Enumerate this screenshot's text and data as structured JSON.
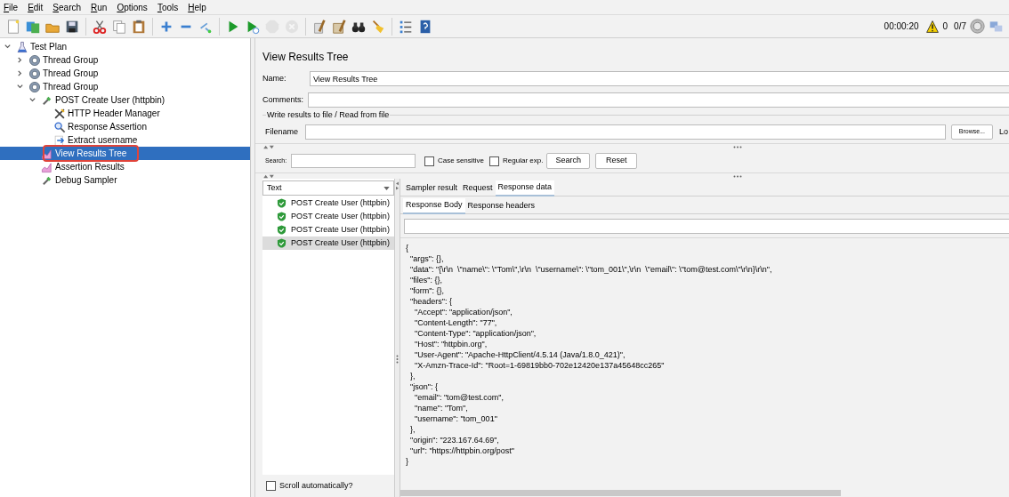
{
  "menu": [
    "File",
    "Edit",
    "Search",
    "Run",
    "Options",
    "Tools",
    "Help"
  ],
  "toolbar": [
    {
      "kind": "new",
      "disabled": false
    },
    {
      "kind": "templates",
      "disabled": false
    },
    {
      "kind": "open",
      "disabled": false
    },
    {
      "kind": "save",
      "disabled": false
    },
    {
      "kind": "separator"
    },
    {
      "kind": "cut",
      "disabled": false
    },
    {
      "kind": "copy",
      "disabled": false
    },
    {
      "kind": "paste",
      "disabled": false
    },
    {
      "kind": "separator"
    },
    {
      "kind": "expand",
      "disabled": false
    },
    {
      "kind": "collapse",
      "disabled": false
    },
    {
      "kind": "toggle",
      "disabled": false
    },
    {
      "kind": "separator"
    },
    {
      "kind": "start",
      "disabled": false
    },
    {
      "kind": "start-no-pauses",
      "disabled": false
    },
    {
      "kind": "stop",
      "disabled": true
    },
    {
      "kind": "shutdown",
      "disabled": true
    },
    {
      "kind": "separator"
    },
    {
      "kind": "clear",
      "disabled": false
    },
    {
      "kind": "clear-all",
      "disabled": false
    },
    {
      "kind": "search",
      "disabled": false
    },
    {
      "kind": "reset",
      "disabled": false
    },
    {
      "kind": "separator"
    },
    {
      "kind": "functions",
      "disabled": false
    },
    {
      "kind": "help",
      "disabled": false
    }
  ],
  "status": {
    "elapsed": "00:00:20",
    "warnings": "0",
    "threads": "0/7"
  },
  "tree": [
    {
      "label": "Test Plan",
      "kind": "testplan",
      "expanded": true,
      "selected": false,
      "children": [
        {
          "label": "Thread Group",
          "kind": "threadgroup",
          "expanded": false,
          "selected": false
        },
        {
          "label": "Thread Group",
          "kind": "threadgroup",
          "expanded": false,
          "selected": false
        },
        {
          "label": "Thread Group",
          "kind": "threadgroup",
          "expanded": true,
          "selected": false,
          "children": [
            {
              "label": "POST Create User (httpbin)",
              "kind": "sampler",
              "expanded": true,
              "selected": false,
              "children": [
                {
                  "label": "HTTP Header Manager",
                  "kind": "config",
                  "selected": false
                },
                {
                  "label": "Response Assertion",
                  "kind": "assertion",
                  "selected": false
                },
                {
                  "label": "Extract username",
                  "kind": "extractor",
                  "selected": false
                }
              ]
            },
            {
              "label": "View Results Tree",
              "kind": "listener",
              "selected": true,
              "highlighted": true
            },
            {
              "label": "Assertion Results",
              "kind": "listener",
              "selected": false
            },
            {
              "label": "Debug Sampler",
              "kind": "sampler",
              "selected": false
            }
          ]
        }
      ]
    }
  ],
  "panel": {
    "title": "View Results Tree",
    "name_label": "Name:",
    "name_value": "View Results Tree",
    "comments_label": "Comments:",
    "file_group": "Write results to file / Read from file",
    "filename_label": "Filename",
    "browse": "Browse...",
    "log": "Lo",
    "search_label": "Search:",
    "case_sensitive": {
      "label": "Case sensitive",
      "checked": false
    },
    "regex": {
      "label": "Regular exp.",
      "checked": false
    },
    "search_button": "Search",
    "reset_button": "Reset"
  },
  "renderer": "Text",
  "results": [
    {
      "label": "POST Create User (httpbin)",
      "passed": true,
      "selected": false
    },
    {
      "label": "POST Create User (httpbin)",
      "passed": true,
      "selected": false
    },
    {
      "label": "POST Create User (httpbin)",
      "passed": true,
      "selected": false
    },
    {
      "label": "POST Create User (httpbin)",
      "passed": true,
      "selected": true
    }
  ],
  "scroll_auto": {
    "label": "Scroll automatically?",
    "checked": false
  },
  "tabs": [
    {
      "label": "Sampler result",
      "selected": false
    },
    {
      "label": "Request",
      "selected": false
    },
    {
      "label": "Response data",
      "selected": true
    }
  ],
  "subtabs": [
    {
      "label": "Response Body",
      "selected": true
    },
    {
      "label": "Response headers",
      "selected": false
    }
  ],
  "body": [
    "{",
    "  \"args\": {},",
    "  \"data\": \"{\\r\\n  \\\"name\\\": \\\"Tom\\\",\\r\\n  \\\"username\\\": \\\"tom_001\\\",\\r\\n  \\\"email\\\": \\\"tom@test.com\\\"\\r\\n}\\r\\n\",",
    "  \"files\": {},",
    "  \"form\": {},",
    "  \"headers\": {",
    "    \"Accept\": \"application/json\",",
    "    \"Content-Length\": \"77\",",
    "    \"Content-Type\": \"application/json\",",
    "    \"Host\": \"httpbin.org\",",
    "    \"User-Agent\": \"Apache-HttpClient/4.5.14 (Java/1.8.0_421)\",",
    "    \"X-Amzn-Trace-Id\": \"Root=1-69819bb0-702e12420e137a45648cc265\"",
    "  },",
    "  \"json\": {",
    "    \"email\": \"tom@test.com\",",
    "    \"name\": \"Tom\",",
    "    \"username\": \"tom_001\"",
    "  },",
    "  \"origin\": \"223.167.64.69\",",
    "  \"url\": \"https://httpbin.org/post\"",
    "}"
  ]
}
